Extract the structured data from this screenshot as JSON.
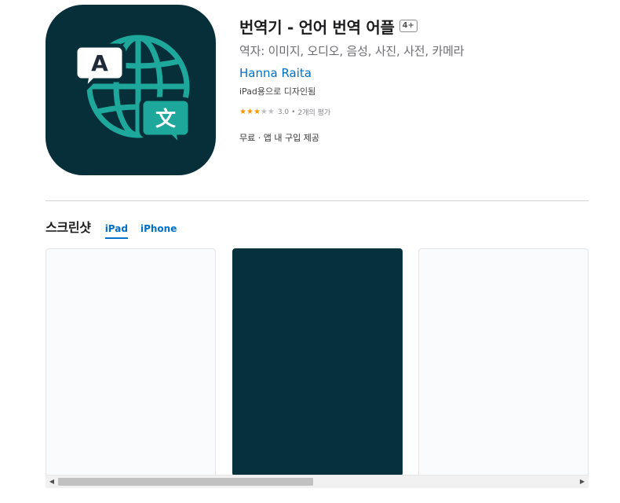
{
  "app": {
    "title": "번역기 - 언어 번역 어플",
    "age_rating": "4+",
    "subtitle": "역자: 이미지, 오디오, 음성, 사진, 사전, 카메라",
    "developer": "Hanna Raita",
    "designed_for": "iPad용으로 디자인됨",
    "rating": {
      "value": "3.0",
      "stars": 3,
      "max_stars": 5,
      "separator": "•",
      "count": "2개의 평가"
    },
    "price": "무료 · 앱 내 구입 제공",
    "icon": {
      "letter_a": "A",
      "glyph_wen": "文",
      "bg_color": "#062f3a",
      "accent_color": "#1ea89b"
    }
  },
  "screenshots": {
    "title": "스크린샷",
    "tabs": [
      {
        "label": "iPad",
        "active": true
      },
      {
        "label": "iPhone",
        "active": false
      }
    ],
    "items": [
      {
        "theme": "light",
        "color": "#fafbfc"
      },
      {
        "theme": "dark",
        "color": "#06303b"
      },
      {
        "theme": "light",
        "color": "#fafbfc"
      }
    ],
    "scroll_position": 0.45
  }
}
